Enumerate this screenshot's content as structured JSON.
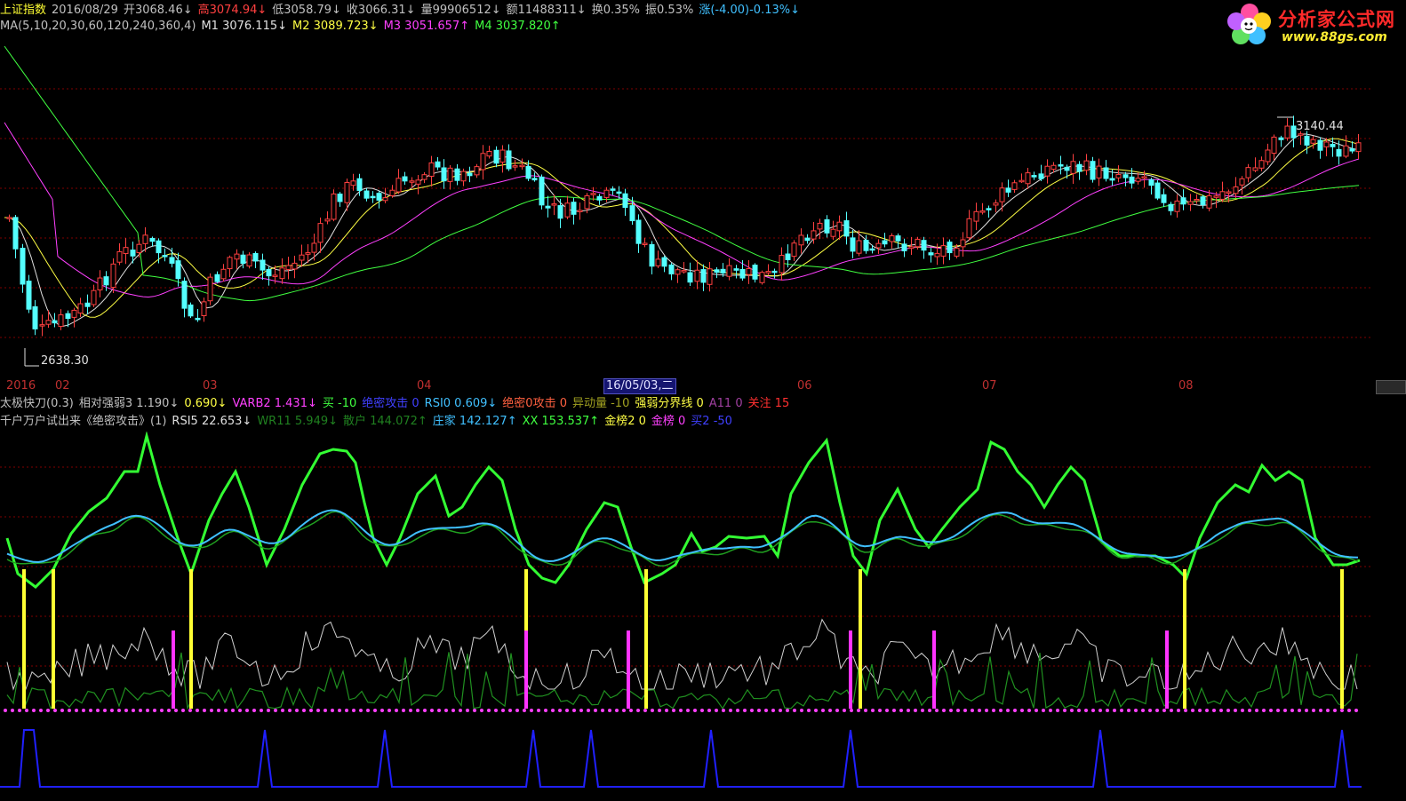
{
  "header": {
    "items": [
      {
        "text": "上证指数",
        "color": "#ffff33"
      },
      {
        "text": "2016/08/29",
        "color": "#c0c0c0"
      },
      {
        "text": "开3068.46↓",
        "color": "#c0c0c0"
      },
      {
        "text": "高3074.94↓",
        "color": "#ff4040"
      },
      {
        "text": "低3058.79↓",
        "color": "#c0c0c0"
      },
      {
        "text": "收3066.31↓",
        "color": "#c0c0c0"
      },
      {
        "text": "量99906512↓",
        "color": "#c0c0c0"
      },
      {
        "text": "额11488311↓",
        "color": "#c0c0c0"
      },
      {
        "text": "换0.35%",
        "color": "#c0c0c0"
      },
      {
        "text": "振0.53%",
        "color": "#c0c0c0"
      },
      {
        "text": "涨(-4.00)-0.13%↓",
        "color": "#40c0ff"
      }
    ]
  },
  "ma_line": {
    "items": [
      {
        "text": "MA(5,10,20,30,60,120,240,360,4)",
        "color": "#c0c0c0"
      },
      {
        "text": "M1 3076.115↓",
        "color": "#e0e0e0"
      },
      {
        "text": "M2 3089.723↓",
        "color": "#ffff44"
      },
      {
        "text": "M3 3051.657↑",
        "color": "#ff40ff"
      },
      {
        "text": "M4 3037.820↑",
        "color": "#40ff40"
      }
    ]
  },
  "logo": {
    "title": "分析家公式网",
    "url": "www.88gs.com"
  },
  "main_chart_labels": {
    "high": "3140.44",
    "low": "2638.30"
  },
  "date_axis": {
    "labels": [
      "2016",
      "02",
      "03",
      "04",
      "06",
      "07",
      "08"
    ],
    "cursor": "16/05/03,二"
  },
  "indicator_line1": {
    "items": [
      {
        "text": "太极快刀(0.3)",
        "color": "#c0c0c0"
      },
      {
        "text": "相对强弱3 1.190↓",
        "color": "#c0c0c0"
      },
      {
        "text": "0.690↓",
        "color": "#ffff44"
      },
      {
        "text": "VARB2 1.431↓",
        "color": "#ff40ff"
      },
      {
        "text": "买 -10",
        "color": "#40ff40"
      },
      {
        "text": "绝密攻击 0",
        "color": "#4040ff"
      },
      {
        "text": "RSI0 0.609↓",
        "color": "#40c0ff"
      },
      {
        "text": "绝密0攻击 0",
        "color": "#ff6040"
      },
      {
        "text": "异动量 -10",
        "color": "#a0a020"
      },
      {
        "text": "强弱分界线 0",
        "color": "#ffff44"
      },
      {
        "text": "A11 0",
        "color": "#a040a0"
      },
      {
        "text": "关注 15",
        "color": "#ff3030"
      }
    ]
  },
  "indicator_line2": {
    "items": [
      {
        "text": "千户万户试出来《绝密攻击》(1)",
        "color": "#c0c0c0"
      },
      {
        "text": "RSI5 22.653↓",
        "color": "#e0e0e0"
      },
      {
        "text": "WR11 5.949↓",
        "color": "#208020"
      },
      {
        "text": "散户 144.072↑",
        "color": "#208020"
      },
      {
        "text": "庄家 142.127↑",
        "color": "#40c0ff"
      },
      {
        "text": "XX 153.537↑",
        "color": "#40ff40"
      },
      {
        "text": "金榜2 0",
        "color": "#ffff44"
      },
      {
        "text": "金榜 0",
        "color": "#ff40ff"
      },
      {
        "text": "买2 -50",
        "color": "#4040ff"
      }
    ]
  },
  "colors": {
    "up": "#ff4040",
    "down": "#54ffff",
    "grid": "#800000",
    "ma1": "#e0e0e0",
    "ma2": "#ffff44",
    "ma3": "#ff40ff",
    "ma4": "#40ff40"
  }
}
